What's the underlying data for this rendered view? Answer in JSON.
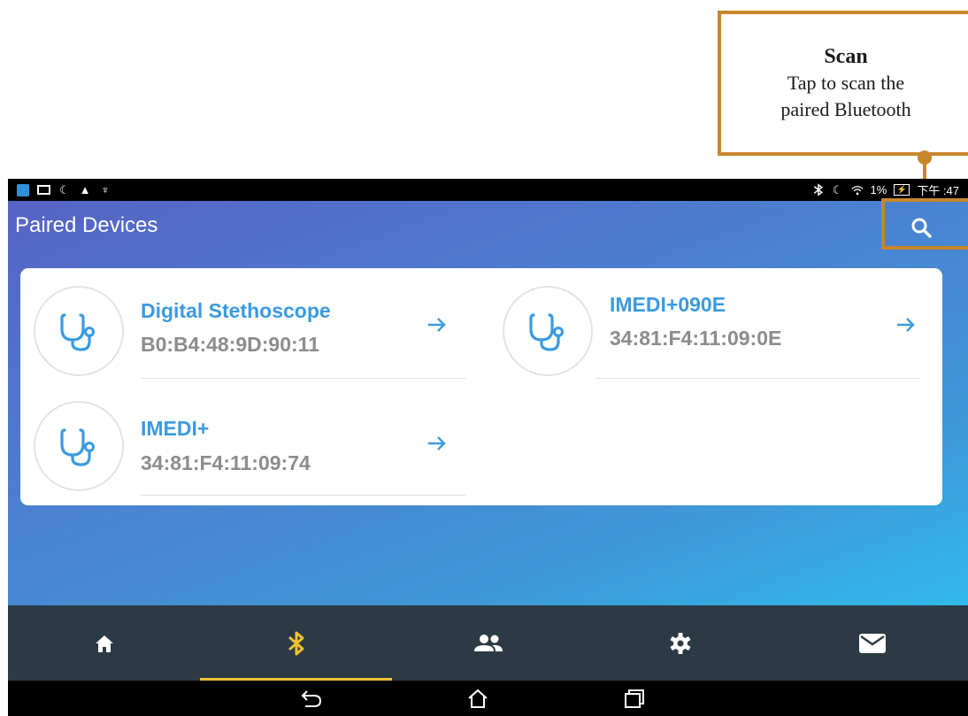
{
  "annotation": {
    "title": "Scan",
    "line1": "Tap to scan the",
    "line2": "paired Bluetooth",
    "color": "#c8862a"
  },
  "status_bar": {
    "left_icons": [
      "app-icon",
      "picture-icon",
      "moon-icon",
      "warning-icon",
      "usb-icon"
    ],
    "right_icons": [
      "bluetooth-icon",
      "moon-icon",
      "wifi-icon",
      "battery-icon"
    ],
    "battery_text": "1%",
    "time": "下午 :47"
  },
  "header": {
    "title": "Paired Devices",
    "search_icon": "search-icon"
  },
  "devices": [
    {
      "name": "Digital Stethoscope",
      "mac": "B0:B4:48:9D:90:11",
      "icon": "stethoscope-icon"
    },
    {
      "name": "IMEDI+090E",
      "mac": "34:81:F4:11:09:0E",
      "icon": "stethoscope-icon"
    },
    {
      "name": "IMEDI+",
      "mac": "34:81:F4:11:09:74",
      "icon": "stethoscope-icon"
    }
  ],
  "bottom_nav": {
    "items": [
      {
        "icon": "home-icon",
        "active": false
      },
      {
        "icon": "bluetooth-icon",
        "active": true
      },
      {
        "icon": "people-icon",
        "active": false
      },
      {
        "icon": "settings-icon",
        "active": false
      },
      {
        "icon": "mail-icon",
        "active": false
      }
    ],
    "active_color": "#f1c232"
  },
  "system_nav": [
    "back-icon",
    "home-outline-icon",
    "recents-icon"
  ],
  "colors": {
    "accent_blue": "#3b9ae0",
    "text_gray": "#8c8c8c",
    "nav_bg": "#2c3a44",
    "gradient_start": "#5663c4",
    "gradient_end": "#31b9ec"
  }
}
